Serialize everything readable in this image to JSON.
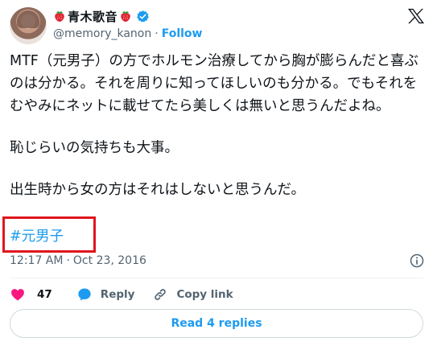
{
  "author": {
    "display_name": "青木歌音",
    "handle": "@memory_kanon",
    "separator": "·",
    "follow_label": "Follow"
  },
  "tweet": {
    "paragraphs": [
      "MTF（元男子）の方でホルモン治療してから胸が膨らんだと喜ぶのは分かる。それを周りに知ってほしいのも分かる。でもそれをむやみにネットに載せてたら美しくは無いと思うんだよね。",
      "恥じらいの気持ちも大事。",
      "出生時から女の方はそれはしないと思うんだ。"
    ],
    "hashtag": "#元男子",
    "time": "12:17 AM",
    "date_separator": "·",
    "date": "Oct 23, 2016"
  },
  "actions": {
    "like_count": "47",
    "reply_label": "Reply",
    "copy_link_label": "Copy link"
  },
  "read_replies_label": "Read 4 replies",
  "colors": {
    "accent": "#1d9bf0",
    "like": "#f91880",
    "highlight_box": "#e0161d",
    "muted": "#536471"
  },
  "icons": {
    "verified": "verified-badge-icon",
    "emoji": "strawberry-icon",
    "brand": "x-logo-icon",
    "info": "info-icon",
    "like": "heart-icon",
    "reply": "reply-bubble-icon",
    "copy": "link-icon"
  }
}
